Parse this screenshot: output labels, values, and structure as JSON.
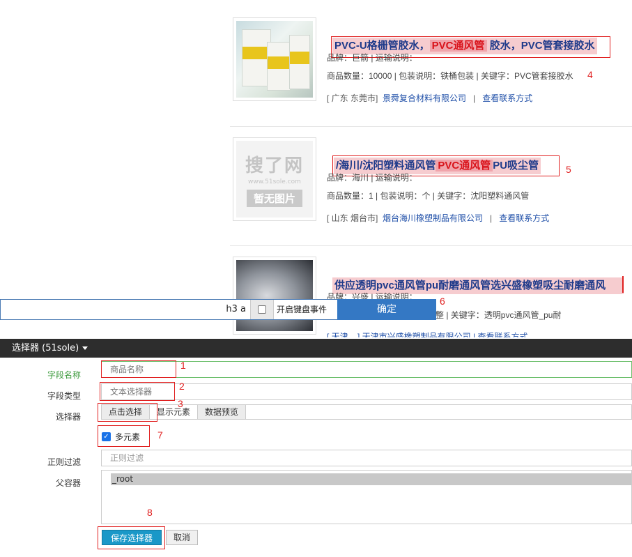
{
  "products": [
    {
      "title_pre": "PVC-U格栅管胶水，",
      "title_hl": "PVC通风管",
      "title_post": "胶水，PVC管套接胶水",
      "brand_line": "品牌：巨箭 | 运输说明：",
      "qty_line": "商品数量：10000 | 包装说明：铁桶包装 | 关键字：PVC管套接胶水",
      "location": "[ 广东 东莞市]",
      "company": "景舜复合材料有限公司",
      "separator": "|",
      "contact": "查看联系方式",
      "annotation": "4"
    },
    {
      "title_pre": "/海川/沈阳塑料通风管",
      "title_hl": "PVC通风管",
      "title_post": "PU吸尘管",
      "brand_line": "品牌：海川 | 运输说明：",
      "qty_line": "商品数量：1 | 包装说明：个 | 关键字：沈阳塑料通风管",
      "location": "[ 山东 烟台市]",
      "company": "烟台海川橡塑制品有限公司",
      "separator": "|",
      "contact": "查看联系方式",
      "annotation": "5",
      "placeholder_logo": "搜了网",
      "placeholder_url": "www.51sole.com",
      "placeholder_text": "暂无图片"
    },
    {
      "title_pre": "供应透明pvc通风管pu耐磨通风管选兴盛橡塑吸尘耐磨通风",
      "brand_line": "品牌：兴盛 | 运输说明：",
      "qty_tail": "整 | 关键字：透明pvc通风管_pu耐",
      "location_partial": "[ 天津 ...] 天津市兴盛橡塑制品有限公司 | 查看联系方式",
      "annotation": "6"
    }
  ],
  "toolbar": {
    "selector_value": "h3 a",
    "keyboard_label": "开启键盘事件",
    "confirm_label": "确定"
  },
  "panel": {
    "title": "选择器 (51sole)"
  },
  "form": {
    "field_name_label": "字段名称",
    "field_name_value": "商品名称",
    "field_type_label": "字段类型",
    "field_type_value": "文本选择器",
    "selector_label": "选择器",
    "btn_click_select": "点击选择",
    "btn_show_elements": "显示元素",
    "btn_preview": "数据预览",
    "multi_label": "多元素",
    "multi_checked": true,
    "regex_label": "正则过滤",
    "regex_placeholder": "正则过滤",
    "parent_label": "父容器",
    "parent_option": "_root",
    "save_label": "保存选择器",
    "cancel_label": "取消"
  },
  "annotations": {
    "a1": "1",
    "a2": "2",
    "a3": "3",
    "a7": "7",
    "a8": "8"
  },
  "colors": {
    "title_blue": "#1e3a8a",
    "highlight_red": "#d9131b",
    "annotation_red": "#e02020",
    "confirm_blue": "#3478c4",
    "save_blue": "#1a98c8"
  }
}
